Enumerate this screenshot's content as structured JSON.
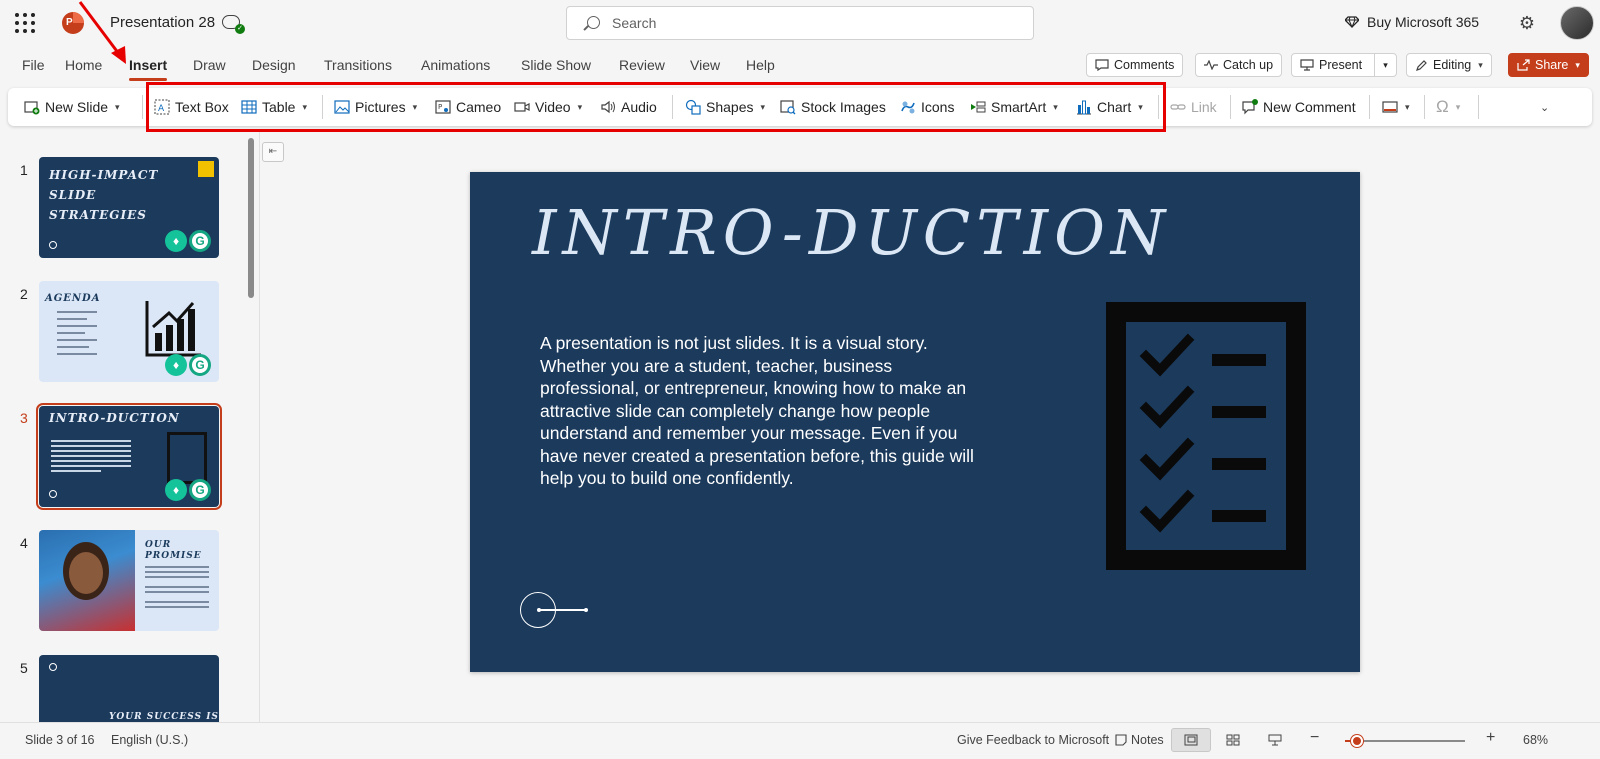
{
  "app": {
    "title": "Presentation 28",
    "search_placeholder": "Search",
    "buy_label": "Buy Microsoft 365"
  },
  "menu": {
    "tabs": [
      {
        "label": "File"
      },
      {
        "label": "Home"
      },
      {
        "label": "Insert",
        "active": true
      },
      {
        "label": "Draw"
      },
      {
        "label": "Design"
      },
      {
        "label": "Transitions"
      },
      {
        "label": "Animations"
      },
      {
        "label": "Slide Show"
      },
      {
        "label": "Review"
      },
      {
        "label": "View"
      },
      {
        "label": "Help"
      }
    ],
    "right_buttons": {
      "comments": "Comments",
      "catchup": "Catch up",
      "present": "Present",
      "editing": "Editing",
      "share": "Share"
    }
  },
  "ribbon": {
    "new_slide": "New Slide",
    "text_box": "Text Box",
    "table": "Table",
    "pictures": "Pictures",
    "cameo": "Cameo",
    "video": "Video",
    "audio": "Audio",
    "shapes": "Shapes",
    "stock_images": "Stock Images",
    "icons": "Icons",
    "smartart": "SmartArt",
    "chart": "Chart",
    "link": "Link",
    "new_comment": "New Comment"
  },
  "thumbnails": [
    {
      "number": "1",
      "title_lines": [
        "HIGH-IMPACT",
        "SLIDE",
        "STRATEGIES"
      ]
    },
    {
      "number": "2",
      "title_lines": [
        "AGENDA"
      ]
    },
    {
      "number": "3",
      "title_lines": [
        "INTRO-DUCTION"
      ],
      "selected": true
    },
    {
      "number": "4",
      "title_lines": [
        "OUR",
        "PROMISE"
      ]
    },
    {
      "number": "5",
      "title_lines": [
        "YOUR SUCCESS IS"
      ]
    }
  ],
  "slide": {
    "title": "INTRO-DUCTION",
    "body": "A presentation is not just slides. It is a visual story. Whether you are a student, teacher, business professional, or entrepreneur, knowing how to make an attractive slide can completely change how people understand and remember your message. Even if you have never created a presentation before, this guide will help you to build one confidently."
  },
  "status": {
    "slide_counter": "Slide 3 of 16",
    "language": "English (U.S.)",
    "feedback": "Give Feedback to Microsoft",
    "notes": "Notes",
    "zoom_out": "−",
    "zoom_in": "+",
    "zoom_level": "68%",
    "zoom_fraction": 0.1
  },
  "colors": {
    "accent": "#c43e1c",
    "slide_bg": "#1b3a5c",
    "highlight": "#e60000"
  }
}
